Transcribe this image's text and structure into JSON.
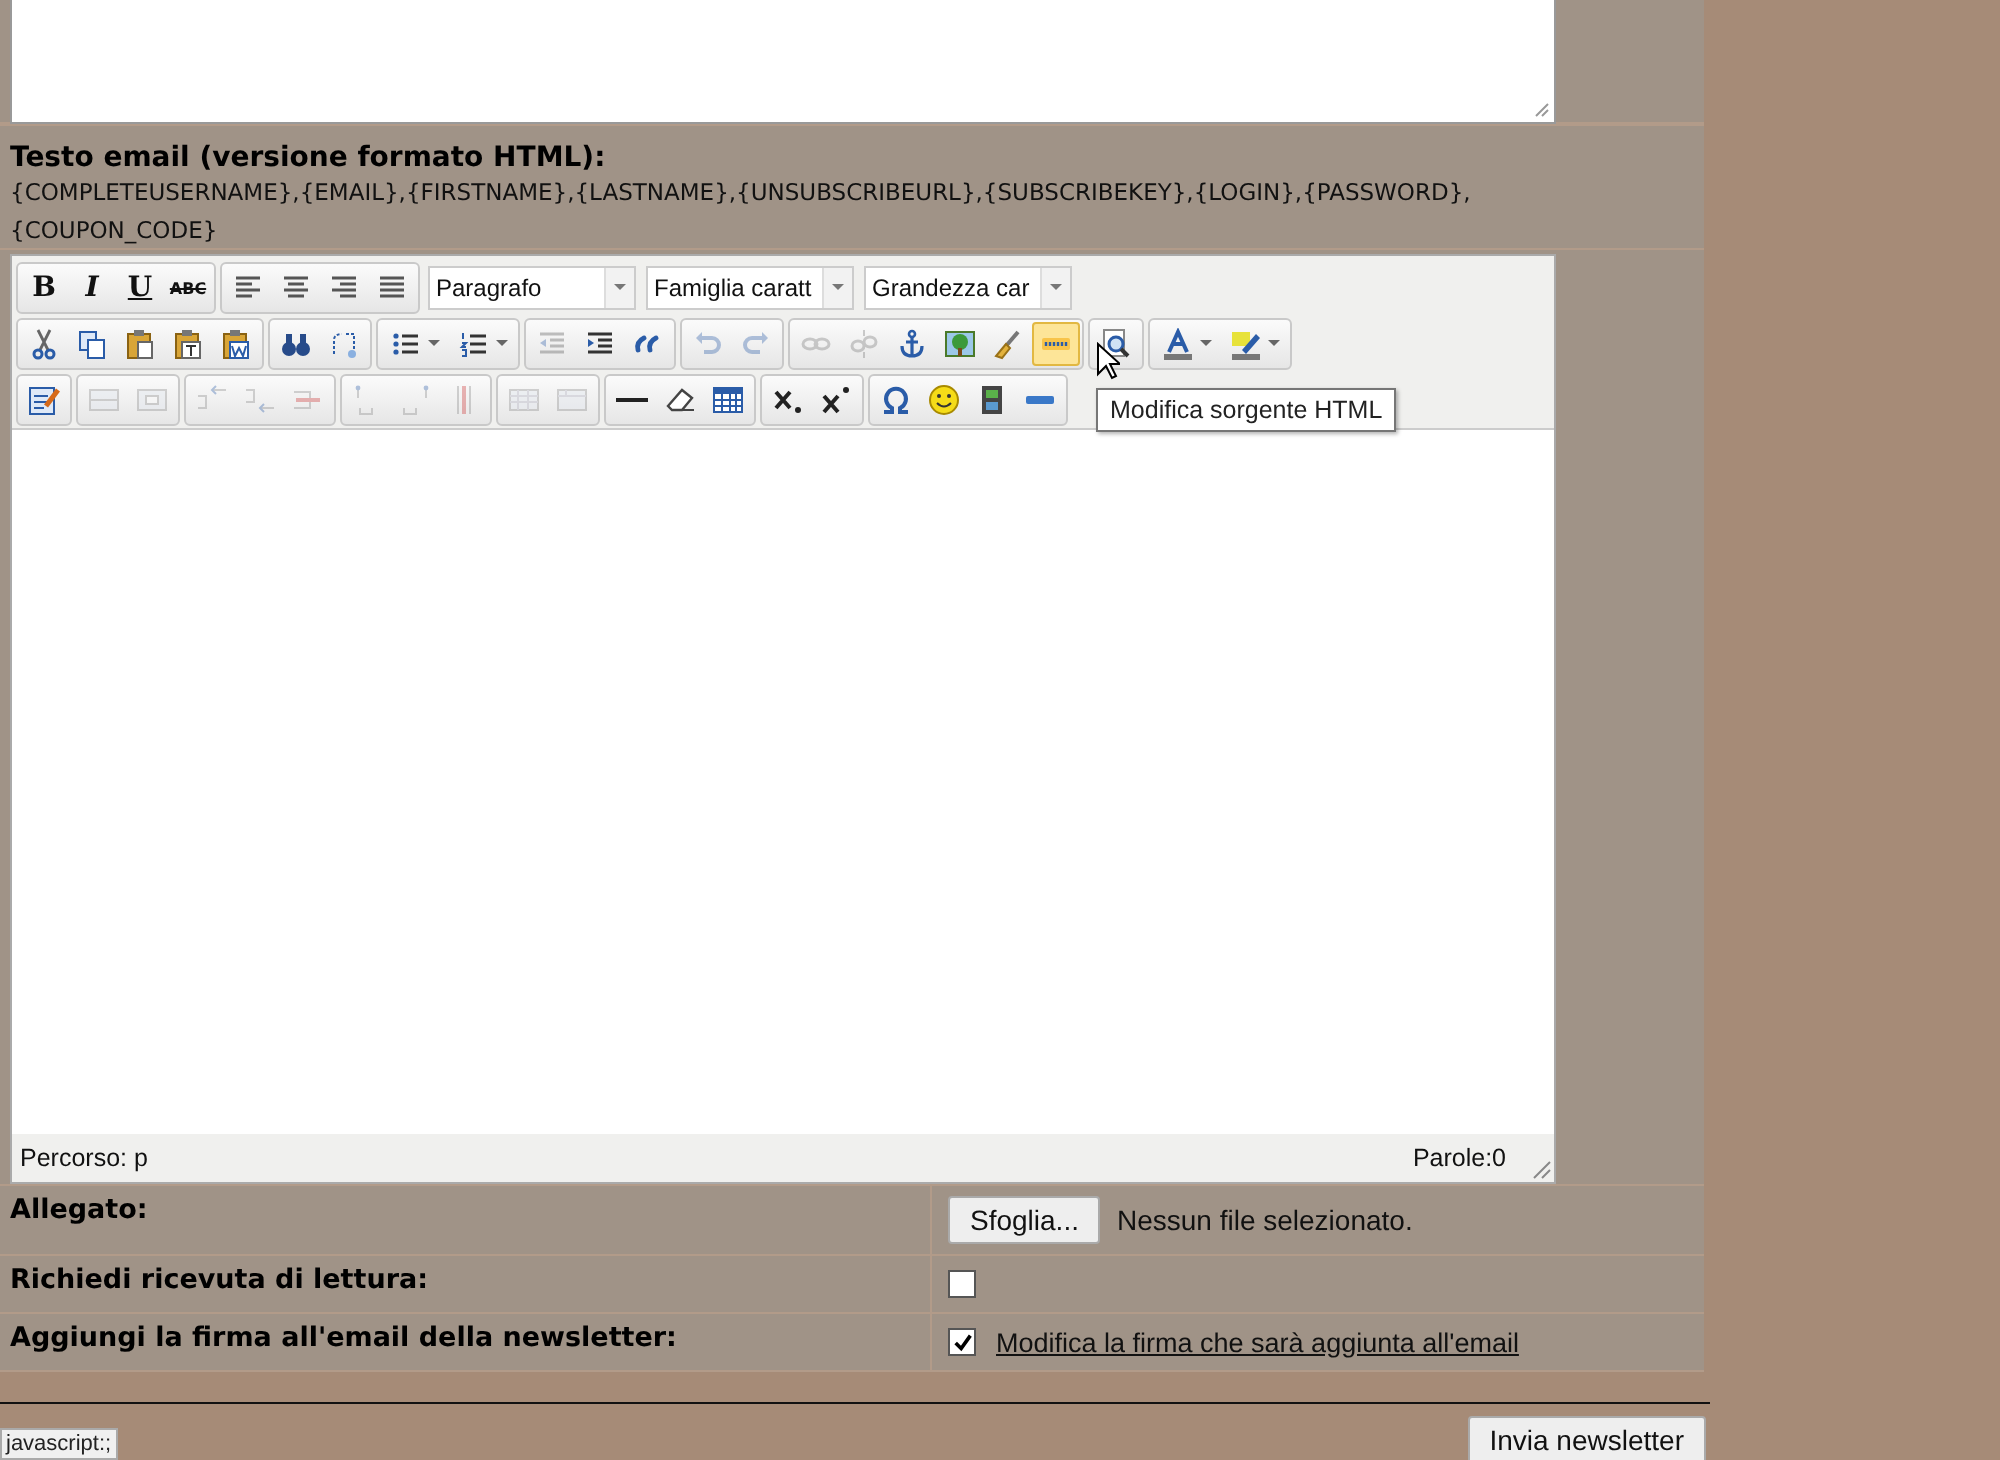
{
  "html_body": {
    "label": "Testo email (versione formato HTML):",
    "tags": "{COMPLETEUSERNAME},{EMAIL},{FIRSTNAME},{LASTNAME},{UNSUBSCRIBEURL},{SUBSCRIBEKEY},{LOGIN},{PASSWORD}, {COUPON_CODE}"
  },
  "editor": {
    "toolbar_rows": [
      [
        {
          "items": [
            {
              "kind": "bold",
              "label": "B",
              "disabled": false
            },
            {
              "kind": "italic",
              "label": "I",
              "disabled": false
            },
            {
              "kind": "underline",
              "label": "U",
              "disabled": false
            },
            {
              "kind": "strike",
              "label": "ABC",
              "disabled": false
            }
          ]
        },
        {
          "items": [
            {
              "kind": "alignleft",
              "disabled": false
            },
            {
              "kind": "aligncenter",
              "disabled": false
            },
            {
              "kind": "alignright",
              "disabled": false
            },
            {
              "kind": "justify",
              "disabled": false
            }
          ]
        },
        {
          "items": [
            {
              "kind": "select",
              "value": "Paragrafo"
            },
            {
              "kind": "select",
              "value": "Famiglia caratt"
            },
            {
              "kind": "select",
              "value": "Grandezza car"
            }
          ]
        }
      ],
      [
        {
          "items": [
            {
              "kind": "cut",
              "disabled": false
            },
            {
              "kind": "copy",
              "disabled": false
            },
            {
              "kind": "paste",
              "disabled": false
            },
            {
              "kind": "pastetext",
              "disabled": false
            },
            {
              "kind": "pasteword",
              "disabled": false
            }
          ]
        },
        {
          "items": [
            {
              "kind": "search",
              "disabled": false
            },
            {
              "kind": "replace",
              "disabled": false
            }
          ]
        },
        {
          "items": [
            {
              "kind": "bullist",
              "disabled": false,
              "menu": true
            },
            {
              "kind": "numlist",
              "disabled": false,
              "menu": true
            }
          ]
        },
        {
          "items": [
            {
              "kind": "outdent",
              "disabled": true
            },
            {
              "kind": "indent",
              "disabled": false
            },
            {
              "kind": "blockquote",
              "disabled": false
            }
          ]
        },
        {
          "items": [
            {
              "kind": "undo",
              "disabled": true
            },
            {
              "kind": "redo",
              "disabled": true
            }
          ]
        },
        {
          "items": [
            {
              "kind": "link",
              "disabled": true
            },
            {
              "kind": "unlink",
              "disabled": true
            },
            {
              "kind": "anchor",
              "disabled": false
            },
            {
              "kind": "image",
              "disabled": false
            },
            {
              "kind": "cleanup",
              "disabled": false
            },
            {
              "kind": "code",
              "disabled": false,
              "hovered": true
            }
          ]
        },
        {
          "items": [
            {
              "kind": "preview",
              "disabled": false
            }
          ]
        },
        {
          "items": [
            {
              "kind": "forecolor",
              "disabled": false,
              "menu": true
            },
            {
              "kind": "backcolor",
              "disabled": false,
              "menu": true
            }
          ]
        }
      ],
      [
        {
          "items": [
            {
              "kind": "edit",
              "disabled": false
            }
          ]
        },
        {
          "items": [
            {
              "kind": "tablerow",
              "disabled": true
            },
            {
              "kind": "tablecell",
              "disabled": true
            }
          ]
        },
        {
          "items": [
            {
              "kind": "rowbefore",
              "disabled": true
            },
            {
              "kind": "rowafter",
              "disabled": true
            },
            {
              "kind": "rowdelete",
              "disabled": true
            }
          ]
        },
        {
          "items": [
            {
              "kind": "colbefore",
              "disabled": true
            },
            {
              "kind": "colafter",
              "disabled": true
            },
            {
              "kind": "coldelete",
              "disabled": true
            }
          ]
        },
        {
          "items": [
            {
              "kind": "split",
              "disabled": true
            },
            {
              "kind": "merge",
              "disabled": true
            }
          ]
        },
        {
          "items": [
            {
              "kind": "hr",
              "disabled": false
            },
            {
              "kind": "eraser",
              "disabled": false
            },
            {
              "kind": "table",
              "disabled": false
            }
          ]
        },
        {
          "items": [
            {
              "kind": "sub",
              "disabled": false
            },
            {
              "kind": "sup",
              "disabled": false
            }
          ]
        },
        {
          "items": [
            {
              "kind": "charmap",
              "disabled": false
            },
            {
              "kind": "smiley",
              "disabled": false
            },
            {
              "kind": "media",
              "disabled": false
            },
            {
              "kind": "rule",
              "disabled": false
            }
          ]
        }
      ]
    ],
    "tooltip": "Modifica sorgente HTML",
    "path": "Percorso: p",
    "word_count": "Parole:0"
  },
  "attachment": {
    "label": "Allegato:",
    "button": "Sfoglia...",
    "status": "Nessun file selezionato."
  },
  "read_receipt": {
    "label": "Richiedi ricevuta di lettura:",
    "checked": false
  },
  "signature": {
    "label": "Aggiungi la firma all'email della newsletter:",
    "checked": true,
    "link": "Modifica la firma che sarà aggiunta all'email"
  },
  "send_button": "Invia newsletter",
  "status_tooltip": "javascript:;"
}
